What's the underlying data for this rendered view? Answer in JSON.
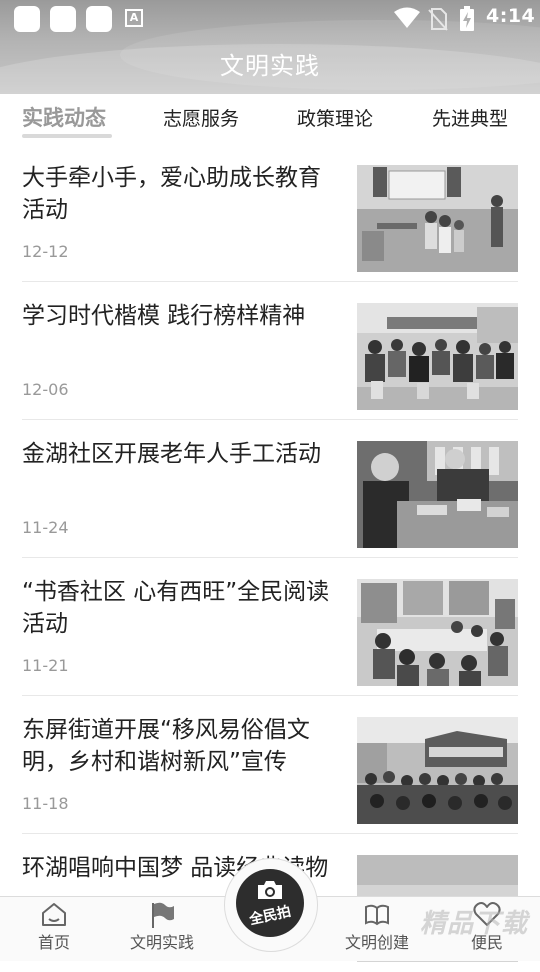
{
  "status_bar": {
    "time": "4:14",
    "notification_icon_letter": "A",
    "icons": [
      "app-notification-icon",
      "wifi-icon",
      "no-sim-icon",
      "battery-charging-icon"
    ]
  },
  "header": {
    "title": "文明实践"
  },
  "tabs": [
    {
      "label": "实践动态",
      "active": true
    },
    {
      "label": "志愿服务",
      "active": false
    },
    {
      "label": "政策理论",
      "active": false
    },
    {
      "label": "先进典型",
      "active": false
    }
  ],
  "articles": [
    {
      "title": "大手牵小手，爱心助成长教育活动",
      "date": "12-12"
    },
    {
      "title": "学习时代楷模 践行榜样精神",
      "date": "12-06"
    },
    {
      "title": "金湖社区开展老年人手工活动",
      "date": "11-24"
    },
    {
      "title": "“书香社区 心有西旺”全民阅读活动",
      "date": "11-21"
    },
    {
      "title": "东屏街道开展“移风易俗倡文明，乡村和谐树新风”宣传",
      "date": "11-18"
    },
    {
      "title": "环湖唱响中国梦 品读经典读物",
      "date": ""
    }
  ],
  "bottom_nav": {
    "items": [
      {
        "label": "首页",
        "icon": "home-icon"
      },
      {
        "label": "文明实践",
        "icon": "flag-icon"
      },
      {
        "label": "文明创建",
        "icon": "book-icon"
      },
      {
        "label": "便民",
        "icon": "heart-icon"
      }
    ],
    "center_label": "全民拍",
    "center_icon": "camera-icon"
  },
  "watermark": "精品下载"
}
